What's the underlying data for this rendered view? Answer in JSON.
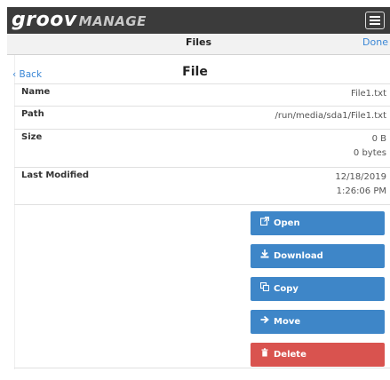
{
  "app": {
    "logo_part1": "groov",
    "logo_part2": "MANAGE"
  },
  "nav": {
    "title": "Files",
    "done_label": "Done"
  },
  "page": {
    "back_label": "Back",
    "title": "File"
  },
  "details": {
    "name_label": "Name",
    "name_value": "File1.txt",
    "path_label": "Path",
    "path_value": "/run/media/sda1/File1.txt",
    "size_label": "Size",
    "size_value_1": "0 B",
    "size_value_2": "0 bytes",
    "modified_label": "Last Modified",
    "modified_date": "12/18/2019",
    "modified_time": "1:26:06 PM"
  },
  "actions": {
    "open_label": "Open",
    "download_label": "Download",
    "copy_label": "Copy",
    "move_label": "Move",
    "delete_label": "Delete"
  },
  "colors": {
    "primary": "#3e86c8",
    "danger": "#d9534f",
    "header": "#3b3b3b",
    "link": "#3a87d6"
  }
}
